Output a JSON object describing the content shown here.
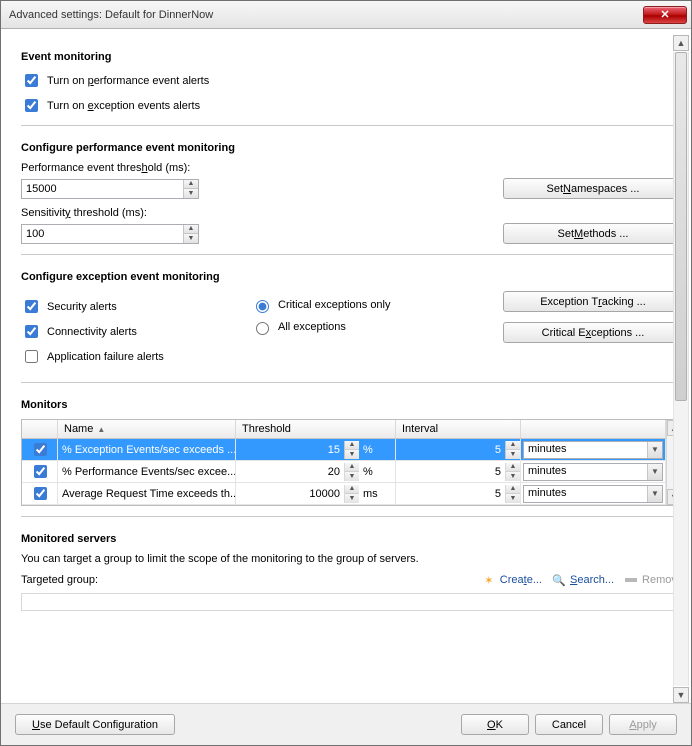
{
  "window": {
    "title": "Advanced settings: Default for DinnerNow"
  },
  "event_monitoring": {
    "heading": "Event monitoring",
    "perf_alerts_label": "Turn on performance event alerts",
    "exc_alerts_label": "Turn on exception events alerts",
    "perf_alerts_checked": true,
    "exc_alerts_checked": true
  },
  "perf_config": {
    "heading": "Configure performance event monitoring",
    "threshold_label": "Performance event threshold (ms):",
    "threshold_value": "15000",
    "sensitivity_label": "Sensitivity threshold (ms):",
    "sensitivity_value": "100",
    "set_namespaces_btn": "Set Namespaces ...",
    "set_methods_btn": "Set Methods ..."
  },
  "exc_config": {
    "heading": "Configure exception event monitoring",
    "security_label": "Security alerts",
    "connectivity_label": "Connectivity alerts",
    "appfail_label": "Application failure alerts",
    "security_checked": true,
    "connectivity_checked": true,
    "appfail_checked": false,
    "critical_only_label": "Critical exceptions only",
    "all_label": "All exceptions",
    "critical_selected": true,
    "tracking_btn": "Exception Tracking ...",
    "critical_btn": "Critical Exceptions ..."
  },
  "monitors": {
    "heading": "Monitors",
    "col_name": "Name",
    "col_threshold": "Threshold",
    "col_interval": "Interval",
    "rows": [
      {
        "checked": true,
        "name": "% Exception Events/sec exceeds ...",
        "threshold": "15",
        "thr_unit": "%",
        "interval": "5",
        "int_unit": "minutes",
        "selected": true
      },
      {
        "checked": true,
        "name": "% Performance Events/sec excee...",
        "threshold": "20",
        "thr_unit": "%",
        "interval": "5",
        "int_unit": "minutes",
        "selected": false
      },
      {
        "checked": true,
        "name": "Average Request Time exceeds th...",
        "threshold": "10000",
        "thr_unit": "ms",
        "interval": "5",
        "int_unit": "minutes",
        "selected": false
      }
    ]
  },
  "servers": {
    "heading": "Monitored servers",
    "desc": "You can target a group to limit the scope of the monitoring to the group of servers.",
    "target_label": "Targeted group:",
    "create": "Create...",
    "search": "Search...",
    "remove": "Remove"
  },
  "footer": {
    "default_btn": "Use Default Configuration",
    "ok": "OK",
    "cancel": "Cancel",
    "apply": "Apply"
  }
}
